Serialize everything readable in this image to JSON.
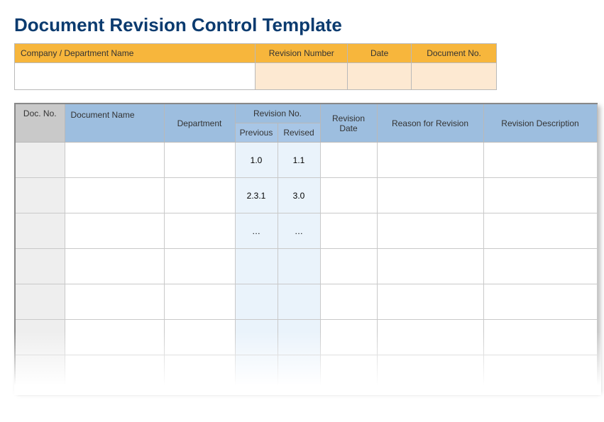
{
  "title": "Document Revision Control Template",
  "info_headers": {
    "company": "Company / Department Name",
    "revision_number": "Revision Number",
    "date": "Date",
    "document_no": "Document No."
  },
  "info_values": {
    "company": "",
    "revision_number": "",
    "date": "",
    "document_no": ""
  },
  "main_headers": {
    "doc_no": "Doc. No.",
    "doc_name": "Document Name",
    "department": "Department",
    "revision_no": "Revision No.",
    "previous": "Previous",
    "revised": "Revised",
    "revision_date": "Revision Date",
    "reason": "Reason for Revision",
    "description": "Revision Description"
  },
  "rows": [
    {
      "doc_no": "",
      "doc_name": "",
      "department": "",
      "previous": "1.0",
      "revised": "1.1",
      "revision_date": "",
      "reason": "",
      "description": ""
    },
    {
      "doc_no": "",
      "doc_name": "",
      "department": "",
      "previous": "2.3.1",
      "revised": "3.0",
      "revision_date": "",
      "reason": "",
      "description": ""
    },
    {
      "doc_no": "",
      "doc_name": "",
      "department": "",
      "previous": "…",
      "revised": "…",
      "revision_date": "",
      "reason": "",
      "description": ""
    },
    {
      "doc_no": "",
      "doc_name": "",
      "department": "",
      "previous": "",
      "revised": "",
      "revision_date": "",
      "reason": "",
      "description": ""
    },
    {
      "doc_no": "",
      "doc_name": "",
      "department": "",
      "previous": "",
      "revised": "",
      "revision_date": "",
      "reason": "",
      "description": ""
    },
    {
      "doc_no": "",
      "doc_name": "",
      "department": "",
      "previous": "",
      "revised": "",
      "revision_date": "",
      "reason": "",
      "description": ""
    },
    {
      "doc_no": "",
      "doc_name": "",
      "department": "",
      "previous": "",
      "revised": "",
      "revision_date": "",
      "reason": "",
      "description": ""
    }
  ]
}
